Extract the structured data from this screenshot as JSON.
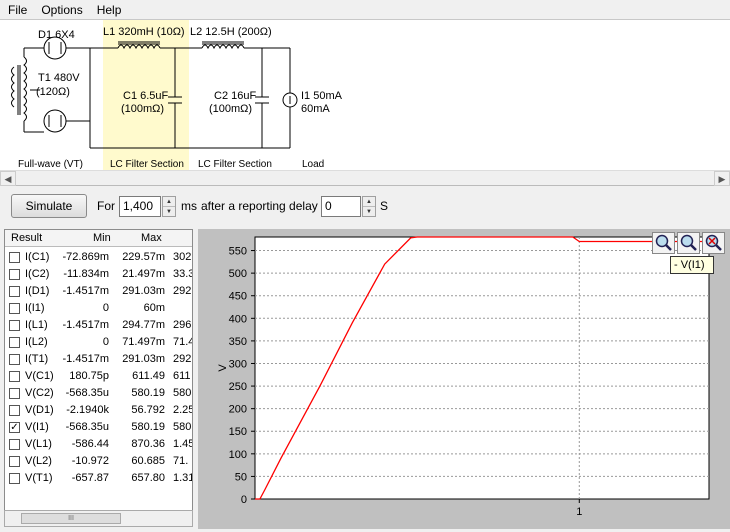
{
  "menu": [
    "File",
    "Options",
    "Help"
  ],
  "schematic": {
    "d1_label": "D1 6X4",
    "l1_label": "L1 320mH (10Ω)",
    "l2_label": "L2 12.5H (200Ω)",
    "t1_label": "T1 480V",
    "t1_res": "(120Ω)",
    "c1_label": "C1 6.5uF",
    "c1_res": "(100mΩ)",
    "c2_label": "C2 16uF",
    "c2_res": "(100mΩ)",
    "i1_label": "I1 50mA",
    "i1_val": "60mA",
    "section_rect": "Full-wave (VT)",
    "section_lc1": "LC Filter Section",
    "section_lc2": "LC Filter Section",
    "section_load": "Load",
    "highlight_color": "#fffacd"
  },
  "toolbar": {
    "simulate_label": "Simulate",
    "for_label": "For",
    "duration_value": "1,400",
    "ms_label": "ms",
    "delay_label": "after a reporting delay of",
    "delay_value": "0",
    "s_label": "S"
  },
  "results": {
    "headers": [
      "Result",
      "Min",
      "Max"
    ],
    "rows": [
      {
        "name": "I(C1)",
        "min": "-72.869m",
        "max": "229.57m",
        "extra": "302.",
        "checked": false
      },
      {
        "name": "I(C2)",
        "min": "-11.834m",
        "max": "21.497m",
        "extra": "33.3",
        "checked": false
      },
      {
        "name": "I(D1)",
        "min": "-1.4517m",
        "max": "291.03m",
        "extra": "292.",
        "checked": false
      },
      {
        "name": "I(I1)",
        "min": "0",
        "max": "60m",
        "extra": "",
        "checked": false
      },
      {
        "name": "I(L1)",
        "min": "-1.4517m",
        "max": "294.77m",
        "extra": "296.",
        "checked": false
      },
      {
        "name": "I(L2)",
        "min": "0",
        "max": "71.497m",
        "extra": "71.4",
        "checked": false
      },
      {
        "name": "I(T1)",
        "min": "-1.4517m",
        "max": "291.03m",
        "extra": "292.",
        "checked": false
      },
      {
        "name": "V(C1)",
        "min": "180.75p",
        "max": "611.49",
        "extra": "611",
        "checked": false
      },
      {
        "name": "V(C2)",
        "min": "-568.35u",
        "max": "580.19",
        "extra": "580",
        "checked": false
      },
      {
        "name": "V(D1)",
        "min": "-2.1940k",
        "max": "56.792",
        "extra": "2.25",
        "checked": false
      },
      {
        "name": "V(I1)",
        "min": "-568.35u",
        "max": "580.19",
        "extra": "580",
        "checked": true
      },
      {
        "name": "V(L1)",
        "min": "-586.44",
        "max": "870.36",
        "extra": "1.45",
        "checked": false
      },
      {
        "name": "V(L2)",
        "min": "-10.972",
        "max": "60.685",
        "extra": "71.",
        "checked": false
      },
      {
        "name": "V(T1)",
        "min": "-657.87",
        "max": "657.80",
        "extra": "1.31",
        "checked": false
      }
    ],
    "scroll_thumb": "III"
  },
  "chart_data": {
    "type": "line",
    "ylabel": "V",
    "ylim": [
      0,
      580
    ],
    "xlim": [
      0,
      1.4
    ],
    "y_ticks": [
      0,
      50,
      100,
      150,
      200,
      250,
      300,
      350,
      400,
      450,
      500,
      550
    ],
    "x_ticks": [
      1
    ],
    "x_tick_labels": [
      "1"
    ],
    "grid": true,
    "series": [
      {
        "name": "V(I1)",
        "color": "#ff0000",
        "x": [
          0,
          0.015,
          0.03,
          0.08,
          0.2,
          0.3,
          0.4,
          0.48,
          0.5,
          0.55,
          0.6,
          0.7,
          0.8,
          0.9,
          0.98,
          1.0,
          1.05,
          1.2,
          1.4
        ],
        "y": [
          0,
          0,
          20,
          90,
          250,
          390,
          520,
          578,
          580,
          580,
          580,
          580,
          580,
          580,
          580,
          570,
          570,
          570,
          570
        ]
      }
    ]
  },
  "zoom": {
    "tooltip": "- V(I1)"
  }
}
